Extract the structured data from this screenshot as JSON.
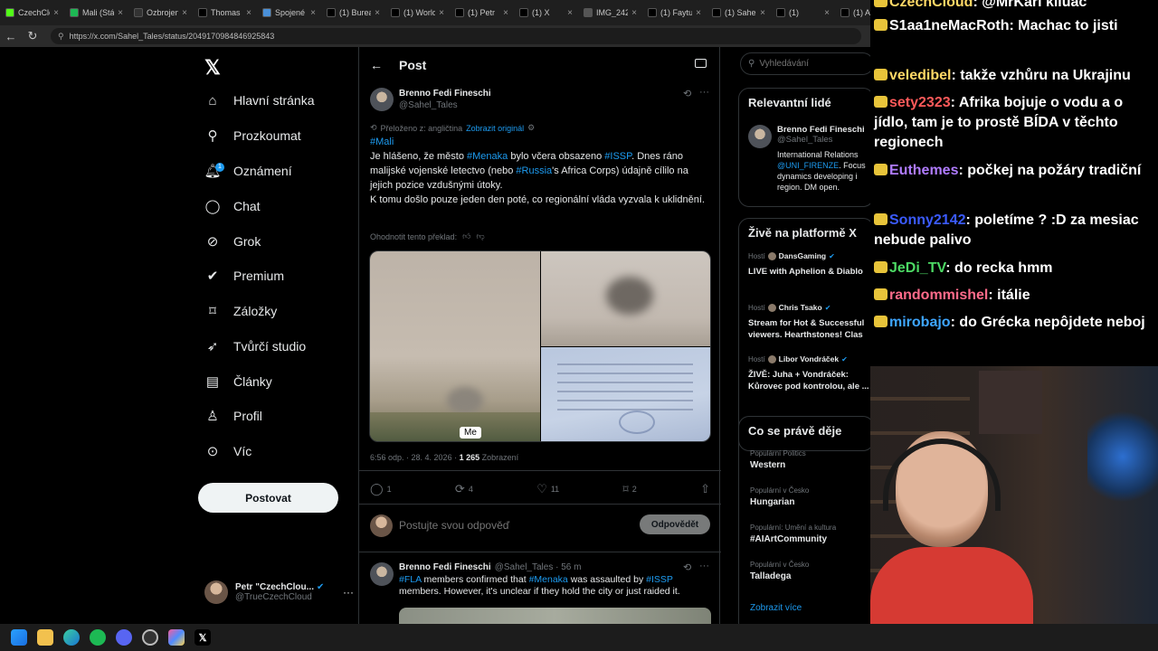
{
  "browser": {
    "tabs": [
      {
        "label": "CzechClo",
        "icon": "kick-icon",
        "color": "#53fc18"
      },
      {
        "label": "Mali (Stál",
        "icon": "m-icon",
        "color": "#1db954"
      },
      {
        "label": "Ozbrojen",
        "icon": "sz-icon",
        "color": "#333333"
      },
      {
        "label": "Thomas",
        "icon": "x-icon",
        "color": "#000000"
      },
      {
        "label": "Spojené",
        "icon": "tab-icon",
        "color": "#4a90d9"
      },
      {
        "label": "(1) Burea",
        "icon": "x-icon",
        "color": "#000000"
      },
      {
        "label": "(1) World",
        "icon": "x-icon",
        "color": "#000000"
      },
      {
        "label": "(1) Petr",
        "icon": "x-icon",
        "color": "#000000"
      },
      {
        "label": "(1) X",
        "icon": "x-icon",
        "color": "#000000"
      },
      {
        "label": "IMG_242",
        "icon": "globe-icon",
        "color": "#555555"
      },
      {
        "label": "(1) Faytu",
        "icon": "x-icon",
        "color": "#000000"
      },
      {
        "label": "(1) Sahel",
        "icon": "x-icon",
        "color": "#000000"
      },
      {
        "label": "(1)",
        "icon": "x-icon",
        "color": "#000000"
      },
      {
        "label": "(1) A",
        "icon": "x-icon",
        "color": "#000000"
      }
    ],
    "url": "https://x.com/Sahel_Tales/status/2049170984846925843"
  },
  "nav": {
    "items": [
      {
        "label": "Hlavní stránka",
        "icon": "home-icon"
      },
      {
        "label": "Prozkoumat",
        "icon": "search-icon"
      },
      {
        "label": "Oznámení",
        "icon": "bell-icon"
      },
      {
        "label": "Chat",
        "icon": "chat-icon"
      },
      {
        "label": "Grok",
        "icon": "grok-icon"
      },
      {
        "label": "Premium",
        "icon": "premium-icon"
      },
      {
        "label": "Záložky",
        "icon": "bookmark-icon"
      },
      {
        "label": "Tvůrčí studio",
        "icon": "rocket-icon"
      },
      {
        "label": "Články",
        "icon": "article-icon"
      },
      {
        "label": "Profil",
        "icon": "person-icon"
      },
      {
        "label": "Víc",
        "icon": "more-icon"
      }
    ],
    "notification_count": "1",
    "post_button": "Postovat",
    "account": {
      "name": "Petr \"CzechClou...",
      "handle": "@TrueCzechCloud"
    }
  },
  "post": {
    "header": "Post",
    "author": "Brenno Fedi Fineschi",
    "handle": "@Sahel_Tales",
    "translated_from": "Přeloženo z: angličtina",
    "show_original": "Zobrazit originál",
    "text": {
      "hashtag_mali": "#Mali",
      "l1_a": "Je hlášeno, že město ",
      "l1_menaka": "#Menaka",
      "l1_b": " bylo včera obsazeno ",
      "l1_issp": "#ISSP",
      "l1_c": ". Dnes ráno malijské vojenské letectvo (nebo ",
      "l1_russia": "#Russia",
      "l1_d": "'s Africa Corps) údajně cílilo na jejich pozice vzdušnými útoky.",
      "l2": "K tomu došlo pouze jeden den poté, co regionální vláda vyzvala k uklidnění."
    },
    "rate_translation": "Ohodnotit tento překlad:",
    "media_label": "Me",
    "timestamp": "6:56 odp. · 28. 4. 2026 · ",
    "views_count": "1 265",
    "views_label": " Zobrazení",
    "replies": "1",
    "reposts": "4",
    "likes": "11",
    "bookmarks": "2",
    "reply_placeholder": "Postujte svou odpověď",
    "reply_button": "Odpovědět"
  },
  "reply": {
    "author": "Brenno Fedi Fineschi",
    "handle_time": "@Sahel_Tales · 56 m",
    "fla": "#FLA",
    "a": " members confirmed that ",
    "menaka": "#Menaka",
    "b": " was assaulted by ",
    "issp": "#ISSP",
    "c": " members. However, it's unclear if they hold the city or just raided it."
  },
  "sidebar": {
    "search_placeholder": "Vyhledávání",
    "relevant_title": "Relevantní lidé",
    "relevant_name": "Brenno Fedi Fineschi",
    "relevant_handle": "@Sahel_Tales",
    "relevant_bio_1": "International Relations",
    "relevant_bio_link": "@UNI_FIRENZE",
    "relevant_bio_2": ". Focus",
    "relevant_bio_3": "dynamics developing i",
    "relevant_bio_4": "region. DM open.",
    "live_title": "Živě na platformě X",
    "live": [
      {
        "host_label": "Hostí",
        "host": "DansGaming",
        "title": "LIVE with Aphelion & Diablo"
      },
      {
        "host_label": "Hostí",
        "host": "Chris Tsako",
        "title": "Stream for Hot & Successful viewers. Hearthstones! Clas"
      },
      {
        "host_label": "Hostí",
        "host": "Libor Vondráček",
        "title": "ŽIVĚ: Juha + Vondráček: Kůrovec pod kontrolou, ale ..."
      }
    ],
    "trends_title": "Co se právě děje",
    "trends": [
      {
        "context": "Populární Politics",
        "name": "Western"
      },
      {
        "context": "Populární v Česko",
        "name": "Hungarian"
      },
      {
        "context": "Populární: Umění a kultura",
        "name": "#AIArtCommunity"
      },
      {
        "context": "Populární v Česko",
        "name": "Talladega"
      }
    ],
    "show_more": "Zobrazit více"
  },
  "chat": {
    "messages": [
      {
        "user": "CzechCloud",
        "color": "#ffd866",
        "text": "@MrKari kiluac"
      },
      {
        "user": "S1aa1neMacRoth",
        "color": "#ffffff",
        "text": "Machac to jisti"
      },
      {
        "user": "veledibel",
        "color": "#ffd866",
        "text": "takže vzhůru na Ukrajinu"
      },
      {
        "user": "sety2323",
        "color": "#ff5a5a",
        "text": "Afrika bojuje o vodu a o jídlo, tam je to prostě BÍDA v těchto regionech"
      },
      {
        "user": "Euthemes",
        "color": "#b07cff",
        "text": "počkej na požáry tradiční"
      },
      {
        "user": "Sonny2142",
        "color": "#3b5bff",
        "text": "poletíme ? :D za mesiac nebude palivo"
      },
      {
        "user": "JeDi_TV",
        "color": "#4cd964",
        "text": "do recka hmm"
      },
      {
        "user": "randommishel",
        "color": "#ff6b8a",
        "text": "itálie"
      },
      {
        "user": "mirobajo",
        "color": "#3ea6ff",
        "text": "do Grécka nepôjdete neboj"
      }
    ]
  }
}
